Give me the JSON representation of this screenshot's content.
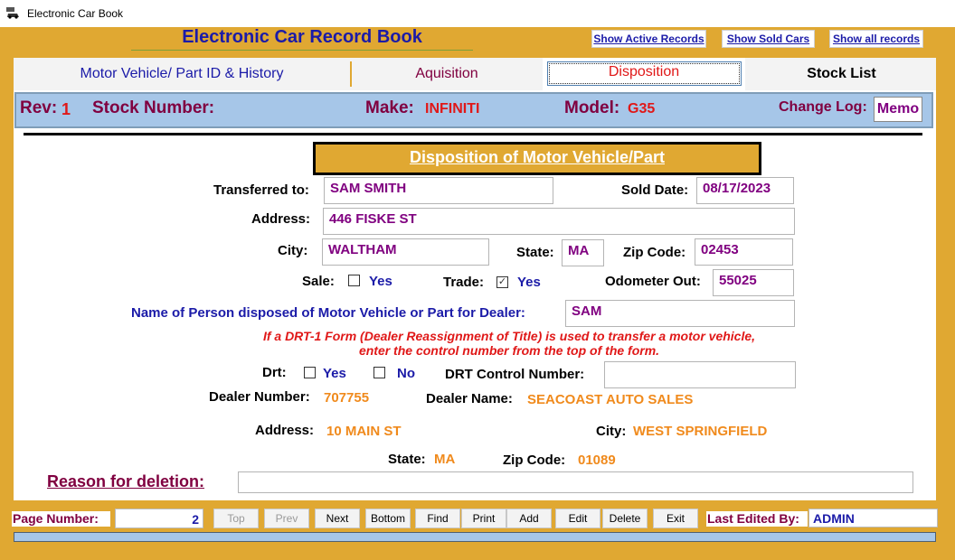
{
  "window": {
    "title": "Electronic Car Book"
  },
  "app": {
    "title": "Electronic Car Record Book"
  },
  "top_buttons": [
    "Show Active Records",
    "Show Sold Cars",
    "Show all records"
  ],
  "tabs": [
    "Motor Vehicle/ Part ID & History",
    "Aquisition",
    "Disposition",
    "Stock List"
  ],
  "header": {
    "rev_label": "Rev:",
    "rev_value": "1",
    "stock_label": "Stock Number:",
    "make_label": "Make:",
    "make_value": "INFINITI",
    "model_label": "Model:",
    "model_value": "G35",
    "changelog_label": "Change Log:",
    "memo_button": "Memo"
  },
  "section_title": "Disposition of Motor Vehicle/Part",
  "form": {
    "transferred_label": "Transferred to:",
    "transferred_value": "SAM SMITH",
    "sold_date_label": "Sold Date:",
    "sold_date_value": "08/17/2023",
    "address_label": "Address:",
    "address_value": "446 FISKE ST",
    "city_label": "City:",
    "city_value": "WALTHAM",
    "state_label": "State:",
    "state_value": "MA",
    "zip_label": "Zip Code:",
    "zip_value": "02453",
    "sale_label": "Sale:",
    "sale_yes": "Yes",
    "trade_label": "Trade:",
    "trade_yes": "Yes",
    "odometer_label": "Odometer Out:",
    "odometer_value": "55025",
    "person_label": "Name of Person disposed of Motor Vehicle or Part for Dealer:",
    "person_value": "SAM",
    "drt_note_line1": "If a DRT-1 Form (Dealer Reassignment of Title) is used to transfer a motor vehicle,",
    "drt_note_line2": "enter the control number from the top of the form.",
    "drt_label": "Drt:",
    "drt_yes": "Yes",
    "drt_no": "No",
    "drt_control_label": "DRT Control Number:",
    "drt_control_value": "",
    "dealer_number_label": "Dealer Number:",
    "dealer_number_value": "707755",
    "dealer_name_label": "Dealer Name:",
    "dealer_name_value": "SEACOAST AUTO SALES",
    "dealer_address_label": "Address:",
    "dealer_address_value": "10 MAIN ST",
    "dealer_city_label": "City:",
    "dealer_city_value": "WEST SPRINGFIELD",
    "dealer_state_label": "State:",
    "dealer_state_value": "MA",
    "dealer_zip_label": "Zip Code:",
    "dealer_zip_value": "01089",
    "reason_label": "Reason for deletion:",
    "reason_value": ""
  },
  "nav": {
    "page_label": "Page Number:",
    "page_value": "2",
    "buttons": [
      "Top",
      "Prev",
      "Next",
      "Bottom",
      "Find",
      "Print",
      "Add",
      "Edit",
      "Delete",
      "Exit"
    ],
    "last_edited_label": "Last Edited By:",
    "last_edited_value": "ADMIN"
  },
  "checkbox_states": {
    "sale": false,
    "trade": true,
    "drt_yes": false,
    "drt_no": false
  }
}
